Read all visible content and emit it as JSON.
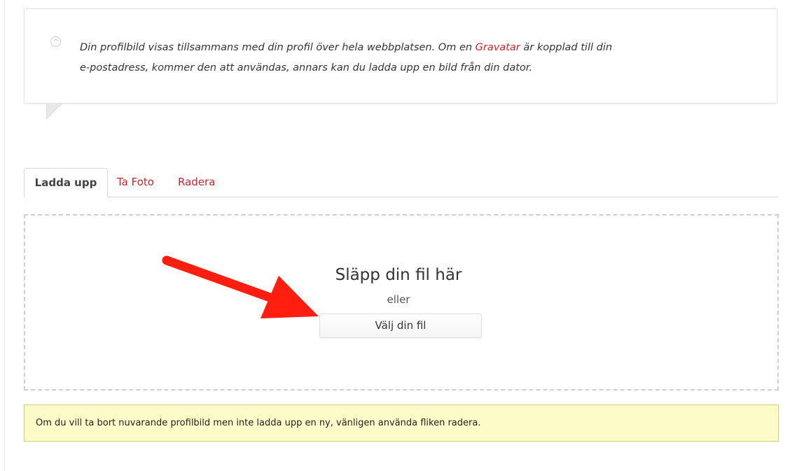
{
  "info": {
    "text_before_link": "Din profilbild visas tillsammans med din profil över hela webbplatsen. Om en ",
    "link_text": "Gravatar",
    "text_after_link": " är kopplad till din",
    "line2": "e-postadress, kommer den att användas, annars kan du ladda upp en bild från din dator."
  },
  "tabs": [
    {
      "label": "Ladda upp",
      "active": true
    },
    {
      "label": "Ta Foto",
      "active": false
    },
    {
      "label": "Radera",
      "active": false
    }
  ],
  "dropzone": {
    "title": "Släpp din fil här",
    "or": "eller",
    "button_label": "Välj din fil"
  },
  "notice": {
    "text": "Om du vill ta bort nuvarande profilbild men inte ladda upp en ny, vänligen använda fliken radera."
  },
  "colors": {
    "link": "#d0232a",
    "arrow": "#ff1e0f",
    "notice_bg": "#fdfbc7",
    "notice_border": "#d4cc73"
  }
}
